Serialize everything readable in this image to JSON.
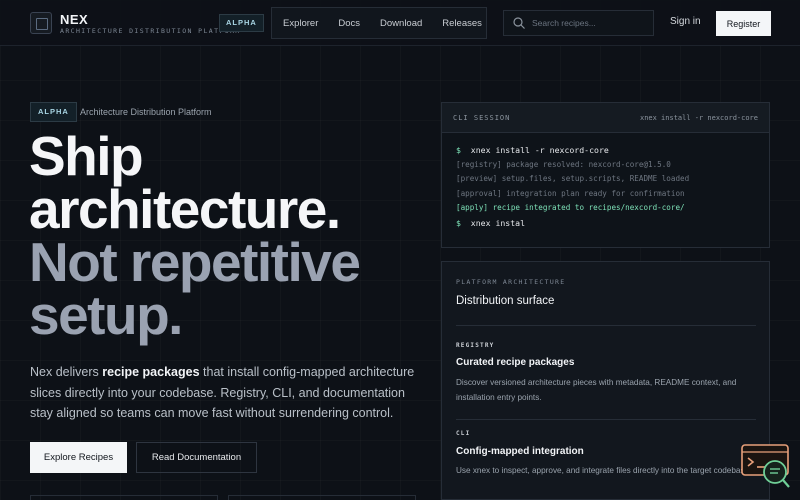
{
  "header": {
    "brand_name": "NEX",
    "brand_subtitle": "ARCHITECTURE DISTRIBUTION PLATFORM",
    "badge": "ALPHA",
    "nav": [
      "Explorer",
      "Docs",
      "Download",
      "Releases"
    ],
    "search_placeholder": "Search recipes...",
    "signin_label": "Sign in",
    "register_label": "Register"
  },
  "hero": {
    "badge": "ALPHA",
    "badge_text": "Architecture Distribution Platform",
    "headline_line1": "Ship",
    "headline_line2": "architecture.",
    "headline_line3": "Not repetitive",
    "headline_line4": "setup.",
    "desc_pre": "Nex delivers ",
    "desc_bold": "recipe packages",
    "desc_post": " that install config-mapped architecture slices directly into your codebase. Registry, CLI, and documentation stay aligned so teams can move fast without surrendering control.",
    "primary_button": "Explore Recipes",
    "secondary_button": "Read Documentation"
  },
  "cli": {
    "label": "CLI SESSION",
    "command_header": "xnex install -r nexcord-core",
    "prompt": "$",
    "lines": [
      {
        "type": "cmd",
        "text": "xnex install -r nexcord-core"
      },
      {
        "type": "dim",
        "text": "[registry] package resolved: nexcord-core@1.5.0"
      },
      {
        "type": "dim",
        "text": "[preview] setup.files, setup.scripts, README loaded"
      },
      {
        "type": "dim",
        "text": "[approval] integration plan ready for confirmation"
      },
      {
        "type": "ok",
        "text": "[apply] recipe integrated to recipes/nexcord-core/"
      },
      {
        "type": "cmd",
        "text": "xnex instal"
      }
    ]
  },
  "architecture": {
    "label": "PLATFORM ARCHITECTURE",
    "title": "Distribution surface",
    "features": [
      {
        "tag": "REGISTRY",
        "title": "Curated recipe packages",
        "desc": "Discover versioned architecture pieces with metadata, README context, and installation entry points."
      },
      {
        "tag": "CLI",
        "title": "Config-mapped integration",
        "desc": "Use xnex to inspect, approve, and integrate files directly into the target codebase."
      }
    ]
  },
  "widget": {
    "icon": "chat-search-icon",
    "accent": "#e8a07a",
    "accent2": "#6fcf97"
  }
}
